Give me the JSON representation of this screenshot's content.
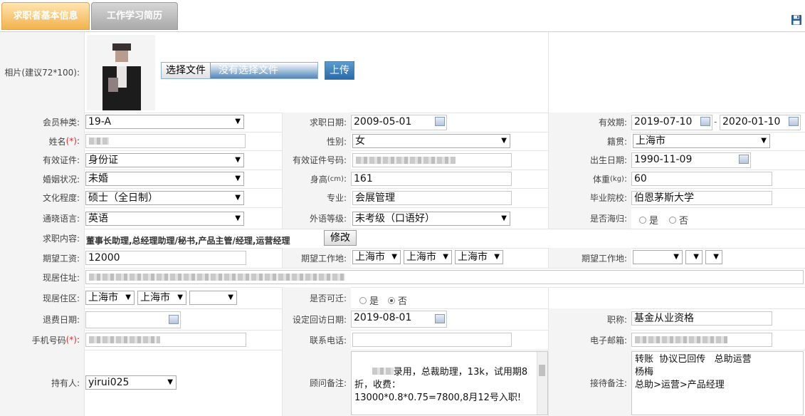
{
  "tabs": {
    "basic": "求职者基本信息",
    "experience": "工作学习简历"
  },
  "photo": {
    "label": "相片(建议72*100):",
    "choose_file": "选择文件",
    "no_file": "没有选择文件",
    "upload": "上传"
  },
  "member_type": {
    "label": "会员种类:",
    "value": "19-A"
  },
  "job_date": {
    "label": "求职日期:",
    "value": "2009-05-01"
  },
  "validity": {
    "label": "有效期:",
    "start": "2019-07-10",
    "sep": "-",
    "end": "2020-01-10"
  },
  "name": {
    "label": "姓名",
    "required": "(*)",
    "colon": ":"
  },
  "gender": {
    "label": "性别:",
    "value": "女"
  },
  "native_place": {
    "label": "籍贯:",
    "value": "上海市"
  },
  "id_type": {
    "label": "有效证件:",
    "value": "身份证"
  },
  "id_number": {
    "label": "有效证件号码:"
  },
  "birth_date": {
    "label": "出生日期:",
    "value": "1990-11-09"
  },
  "marital": {
    "label": "婚姻状况:",
    "value": "未婚"
  },
  "height": {
    "label_main": "身高",
    "label_unit": "(cm)",
    "colon": ":",
    "value": "161"
  },
  "weight": {
    "label_main": "体重",
    "label_unit": "(kg)",
    "colon": ":",
    "value": "60"
  },
  "education": {
    "label": "文化程度:",
    "value": "硕士（全日制）"
  },
  "major": {
    "label": "专业:",
    "value": "会展管理"
  },
  "school": {
    "label": "毕业院校:",
    "value": "伯恩茅斯大学"
  },
  "language": {
    "label": "通晓语言:",
    "value": "英语"
  },
  "foreign_level": {
    "label": "外语等级:",
    "value": "未考级（口语好）"
  },
  "returnee": {
    "label": "是否海归:",
    "yes": "是",
    "no": "否"
  },
  "job_content": {
    "label": "求职内容:",
    "value": "董事长助理,总经理助理/秘书,产品主管/经理,运营经理",
    "modify": "修改"
  },
  "salary": {
    "label": "期望工资:",
    "value": "12000"
  },
  "work_place1": {
    "label": "期望工作地:",
    "a": "上海市",
    "b": "上海市",
    "c": "上海市"
  },
  "work_place2": {
    "label": "期望工作地:"
  },
  "address": {
    "label": "现居住址:"
  },
  "district": {
    "label": "现居住区:",
    "a": "上海市",
    "b": "上海市"
  },
  "relocate": {
    "label": "是否可迁:",
    "yes": "是",
    "no": "否"
  },
  "refund_date": {
    "label": "退费日期:"
  },
  "revisit_date": {
    "label": "设定回访日期:",
    "value": "2019-08-01"
  },
  "title": {
    "label": "职称:",
    "value": "基金从业资格"
  },
  "mobile": {
    "label": "手机号码",
    "required": "(*)",
    "colon": ":"
  },
  "phone": {
    "label": "联系电话:"
  },
  "email": {
    "label": "电子邮箱:"
  },
  "holder": {
    "label": "持有人:",
    "value": "yirui025"
  },
  "consultant_note": {
    "label": "顾问备注:",
    "value": "录用，总裁助理，13k，试用期8折，收费：\n13000*0.8*0.75=7800,8月12号入职!"
  },
  "reception_note": {
    "label": "接待备注:",
    "value": "转账  协议已回传   总助运营\n杨梅\n总助>运营>产品经理"
  },
  "colors": {
    "required": "#e03030",
    "accent_tab": "#f2b24d"
  }
}
